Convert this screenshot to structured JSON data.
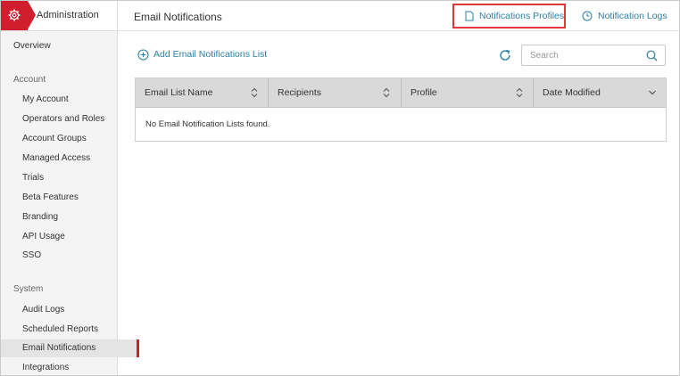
{
  "sidebar": {
    "title": "Administration",
    "overview": "Overview",
    "account_section": "Account",
    "account_items": [
      "My Account",
      "Operators and Roles",
      "Account Groups",
      "Managed Access",
      "Trials",
      "Beta Features",
      "Branding",
      "API Usage",
      "SSO"
    ],
    "system_section": "System",
    "system_items": [
      "Audit Logs",
      "Scheduled Reports",
      "Email Notifications",
      "Integrations"
    ],
    "active_item": "Email Notifications"
  },
  "header": {
    "title": "Email Notifications",
    "profiles_link": "Notifications Profiles",
    "logs_link": "Notification Logs"
  },
  "toolbar": {
    "add_label": "Add Email Notifications List",
    "search_placeholder": "Search"
  },
  "table": {
    "columns": [
      "Email List Name",
      "Recipients",
      "Profile",
      "Date Modified"
    ],
    "empty_message": "No Email Notification Lists found."
  },
  "colors": {
    "accent": "#d01e2e",
    "link": "#2a7fa8",
    "highlight": "#e0383a"
  }
}
